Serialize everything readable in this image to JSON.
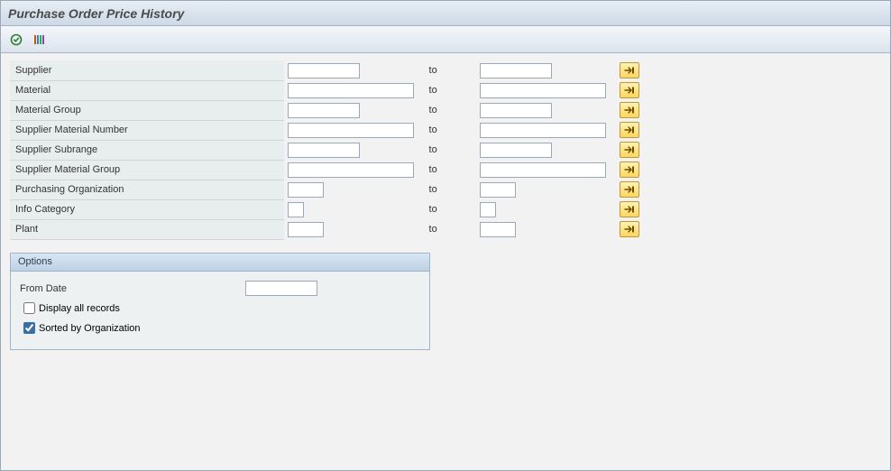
{
  "title": "Purchase Order Price History",
  "selection": {
    "to_label": "to",
    "rows": [
      {
        "label": "Supplier"
      },
      {
        "label": "Material"
      },
      {
        "label": "Material Group"
      },
      {
        "label": "Supplier Material Number"
      },
      {
        "label": "Supplier Subrange"
      },
      {
        "label": "Supplier Material Group"
      },
      {
        "label": "Purchasing Organization"
      },
      {
        "label": "Info Category"
      },
      {
        "label": "Plant"
      }
    ]
  },
  "options": {
    "box_title": "Options",
    "from_date_label": "From Date",
    "from_date_value": "",
    "display_all_label": "Display all records",
    "display_all_checked": false,
    "sorted_by_org_label": "Sorted by Organization",
    "sorted_by_org_checked": true
  }
}
